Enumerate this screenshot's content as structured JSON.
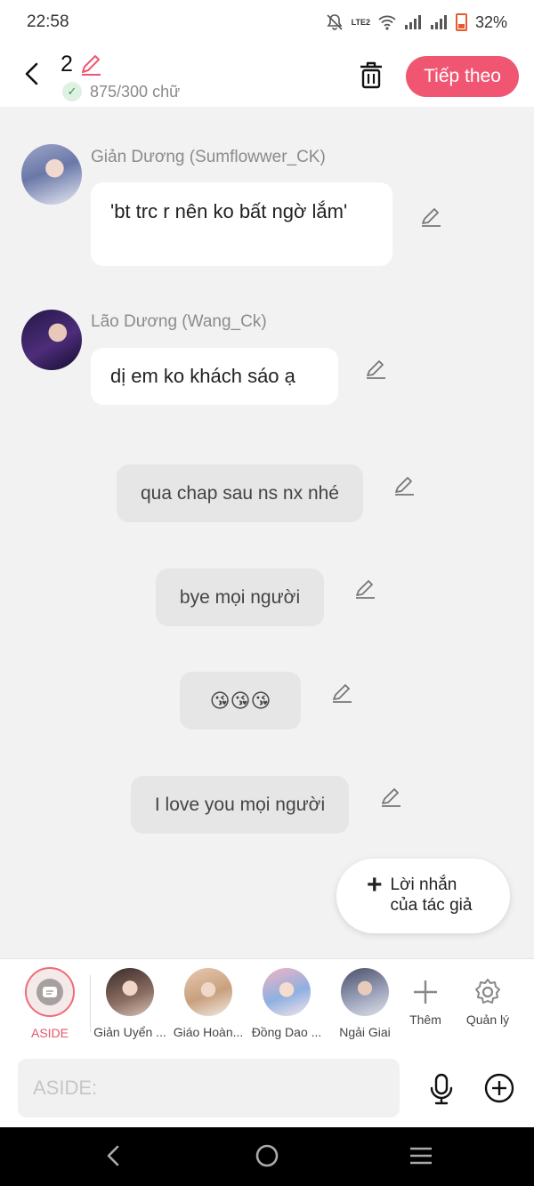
{
  "status_bar": {
    "time": "22:58",
    "network": "LTE2",
    "battery": "32%"
  },
  "header": {
    "chapter_number": "2",
    "char_count": "875/300 chữ",
    "next_label": "Tiếp theo"
  },
  "messages": [
    {
      "sender": "Giản Dương (Sumflowwer_CK)",
      "text": "'bt trc r nên ko bất ngờ lắm'"
    },
    {
      "sender": "Lão Dương (Wang_Ck)",
      "text": "dị em ko khách sáo ạ"
    },
    {
      "text": "qua chap sau ns nx nhé"
    },
    {
      "text": "bye mọi người"
    },
    {
      "text": "😘😘😘"
    },
    {
      "text": "I love you mọi người"
    }
  ],
  "author_note": {
    "label": "Lời nhắn của tác giả"
  },
  "cast_bar": {
    "aside": "ASIDE",
    "characters": [
      "Giản Uyển ...",
      "Giáo Hoàn...",
      "Đồng Dao ...",
      "Ngải Giai"
    ],
    "add": "Thêm",
    "manage": "Quản lý"
  },
  "composer": {
    "placeholder": "ASIDE:"
  },
  "colors": {
    "accent": "#f05672",
    "aside_accent": "#e8546a",
    "check_green": "#2e9a4a"
  }
}
